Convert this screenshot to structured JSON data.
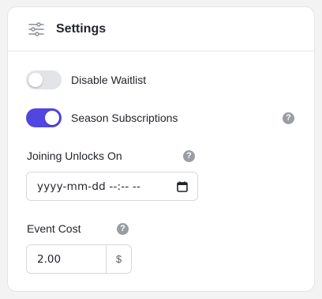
{
  "header": {
    "title": "Settings",
    "icon": "sliders-icon"
  },
  "toggles": [
    {
      "label": "Disable Waitlist",
      "checked": false
    },
    {
      "label": "Season Subscriptions",
      "checked": true,
      "has_help": true
    }
  ],
  "joining_unlocks": {
    "label": "Joining Unlocks On",
    "value": "yyyy-mm-dd --:-- --",
    "icon": "calendar-icon"
  },
  "event_cost": {
    "label": "Event Cost",
    "value": "2.00",
    "currency": "$"
  },
  "help_glyph": "?",
  "colors": {
    "accent": "#5146e0",
    "toggle_off": "#e3e4e7",
    "help": "#9a9da3",
    "border": "#d6d8dc"
  }
}
